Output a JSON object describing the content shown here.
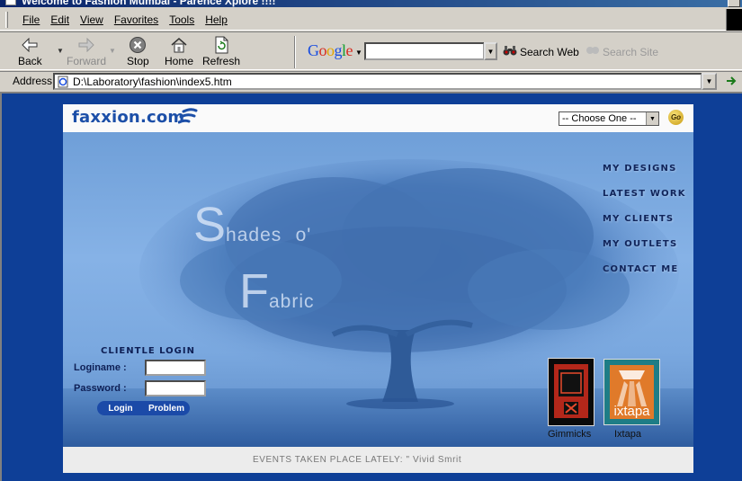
{
  "window": {
    "title": "Welcome to Fashion Mumbai - Parence Xplore !!!!"
  },
  "menu": [
    "File",
    "Edit",
    "View",
    "Favorites",
    "Tools",
    "Help"
  ],
  "toolbar": {
    "back": "Back",
    "forward": "Forward",
    "stop": "Stop",
    "home": "Home",
    "refresh": "Refresh"
  },
  "google_bar": {
    "brand": "Google",
    "search_value": "",
    "search_web": "Search Web",
    "search_site": "Search Site"
  },
  "address_bar": {
    "label": "Address",
    "url": "D:\\Laboratory\\fashion\\index5.htm"
  },
  "site": {
    "brand": "faxxion.com",
    "dropdown_selected": "-- Choose One --",
    "go_label": "Go",
    "tagline": {
      "word1_initial": "S",
      "word1_rest": "hades",
      "word1_suffix": "o'",
      "word2_initial": "F",
      "word2_rest": "abric"
    },
    "nav": [
      "My Designs",
      "Latest Work",
      "My Clients",
      "My Outlets",
      "Contact Me"
    ],
    "login": {
      "title": "CLIENTLE LOGIN",
      "loginname_label": "Loginame :",
      "password_label": "Password :",
      "login_button": "Login",
      "problem_button": "Problem"
    },
    "thumbnails": [
      {
        "caption": "Gimmicks"
      },
      {
        "caption": "Ixtapa",
        "logo_text": "ixtapa"
      }
    ],
    "footer_text": "EVENTS TAKEN PLACE LATELY: \" Vivid Smrit"
  },
  "colors": {
    "desktop_blue": "#0e3f97",
    "brand_blue": "#1c4fa8",
    "hero_sky": "#86b2e6",
    "tree": "#2f5f9e"
  }
}
